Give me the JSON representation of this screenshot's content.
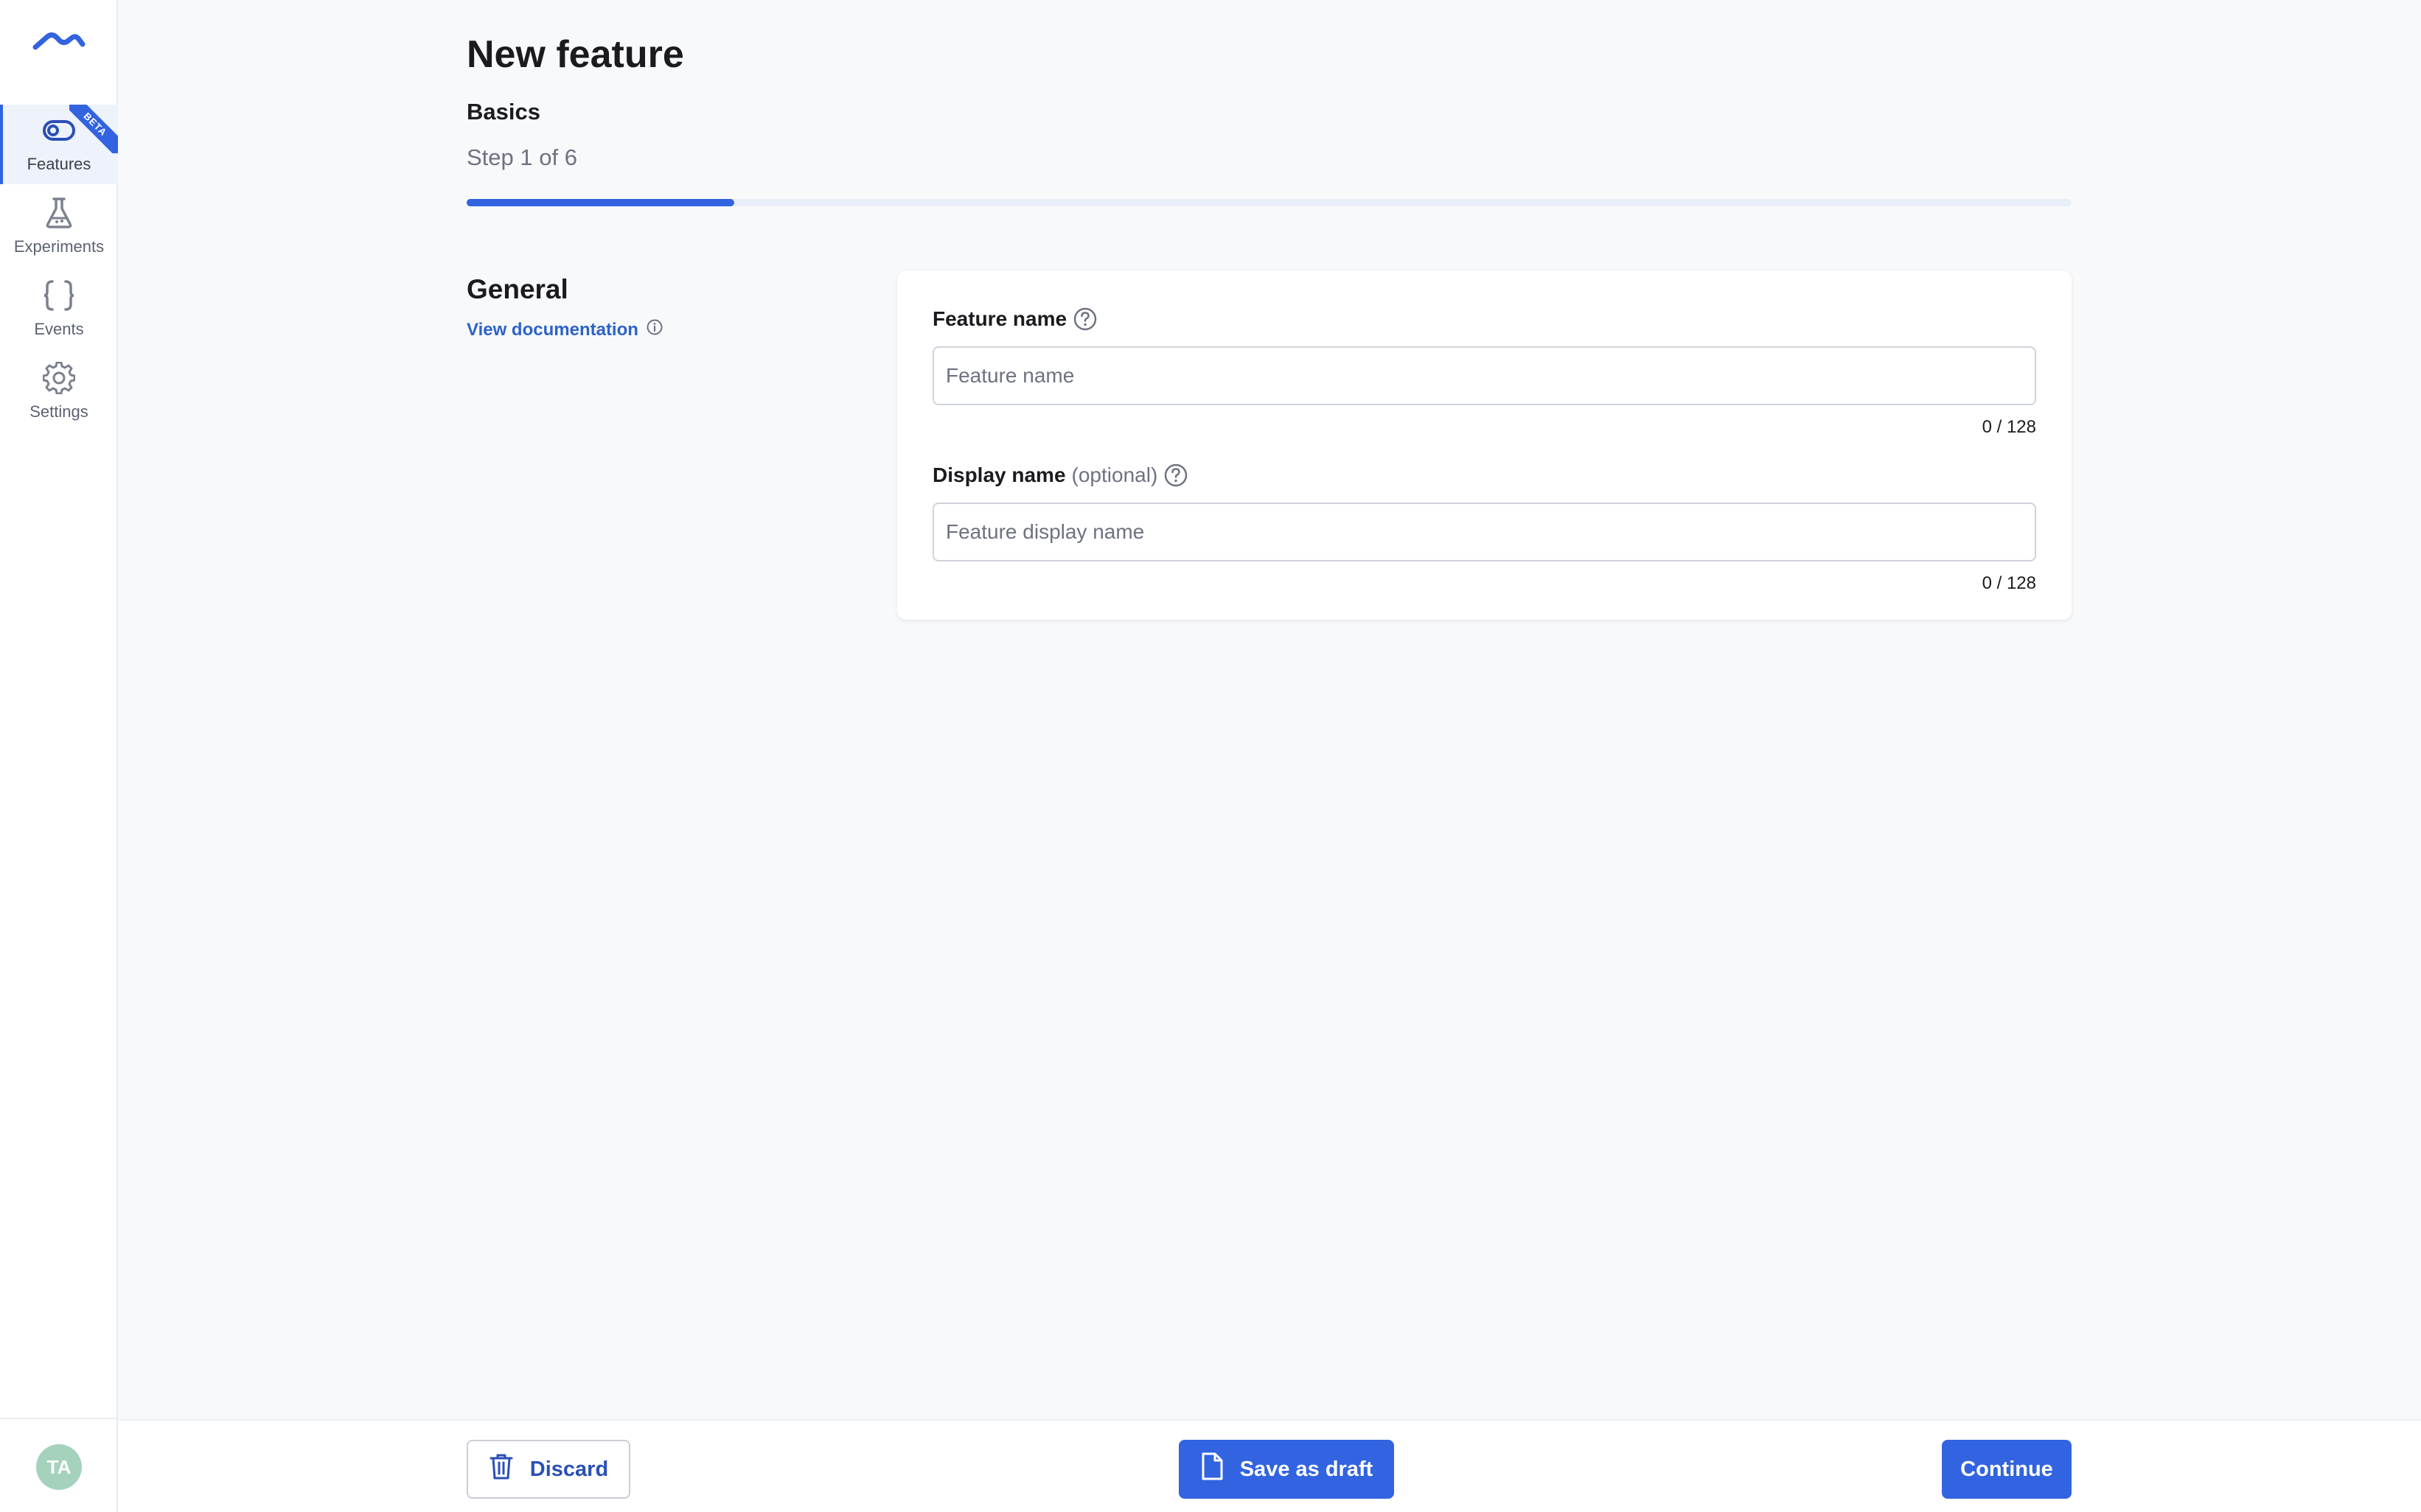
{
  "sidebar": {
    "items": [
      {
        "label": "Features",
        "icon": "toggle-icon",
        "active": true,
        "badge": "BETA"
      },
      {
        "label": "Experiments",
        "icon": "flask-icon",
        "active": false
      },
      {
        "label": "Events",
        "icon": "braces-icon",
        "active": false
      },
      {
        "label": "Settings",
        "icon": "gear-icon",
        "active": false
      }
    ],
    "avatar_initials": "TA"
  },
  "header": {
    "title": "New feature",
    "step_name": "Basics",
    "step_count": "Step 1 of 6",
    "progress_fraction": 0.1667
  },
  "section": {
    "title": "General",
    "doc_link": "View documentation"
  },
  "form": {
    "feature_name": {
      "label": "Feature name",
      "placeholder": "Feature name",
      "value": "",
      "counter": "0 / 128"
    },
    "display_name": {
      "label": "Display name",
      "optional": "(optional)",
      "placeholder": "Feature display name",
      "value": "",
      "counter": "0 / 128"
    }
  },
  "footer": {
    "discard_label": "Discard",
    "draft_label": "Save as draft",
    "continue_label": "Continue"
  },
  "colors": {
    "accent": "#3263e0",
    "link": "#2d62c8",
    "background": "#f7f9fb",
    "avatar": "#a5d2bd"
  }
}
